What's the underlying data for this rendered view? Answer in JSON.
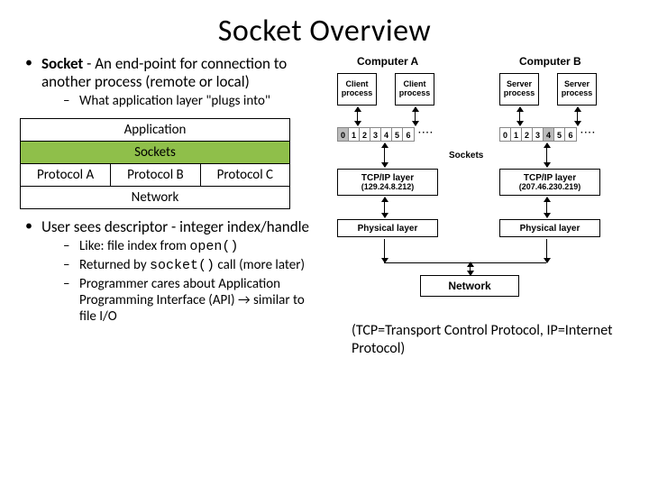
{
  "title": "Socket Overview",
  "bullets": {
    "b1_term": "Socket",
    "b1_rest": " - An end-point for connection to another process (remote or local)",
    "b1_sub1": "What application layer \"plugs into\"",
    "b2_pre": "User sees ",
    "b2_term": "descriptor",
    "b2_rest": " - integer index/handle",
    "b2_sub1_pre": "Like: file index from ",
    "b2_sub1_code": "open()",
    "b2_sub2_pre": "Returned by ",
    "b2_sub2_code": "socket()",
    "b2_sub2_post": " call (more later)",
    "b2_sub3": "Programmer cares about Application Programming Interface (API) → similar to file I/O"
  },
  "stack": {
    "app": "Application",
    "sockets": "Sockets",
    "pa": "Protocol A",
    "pb": "Protocol B",
    "pc": "Protocol C",
    "net": "Network"
  },
  "diagram": {
    "compA": "Computer A",
    "compB": "Computer B",
    "client": "Client process",
    "server": "Server process",
    "ports": [
      "0",
      "1",
      "2",
      "3",
      "4",
      "5",
      "6"
    ],
    "dots": "····",
    "sockets": "Sockets",
    "tcpA_l1": "TCP/IP layer",
    "tcpA_l2": "(129.24.8.212)",
    "tcpB_l1": "TCP/IP layer",
    "tcpB_l2": "(207.46.230.219)",
    "phys": "Physical layer",
    "network": "Network"
  },
  "footnote": "(TCP=Transport Control Protocol, IP=Internet Protocol)"
}
